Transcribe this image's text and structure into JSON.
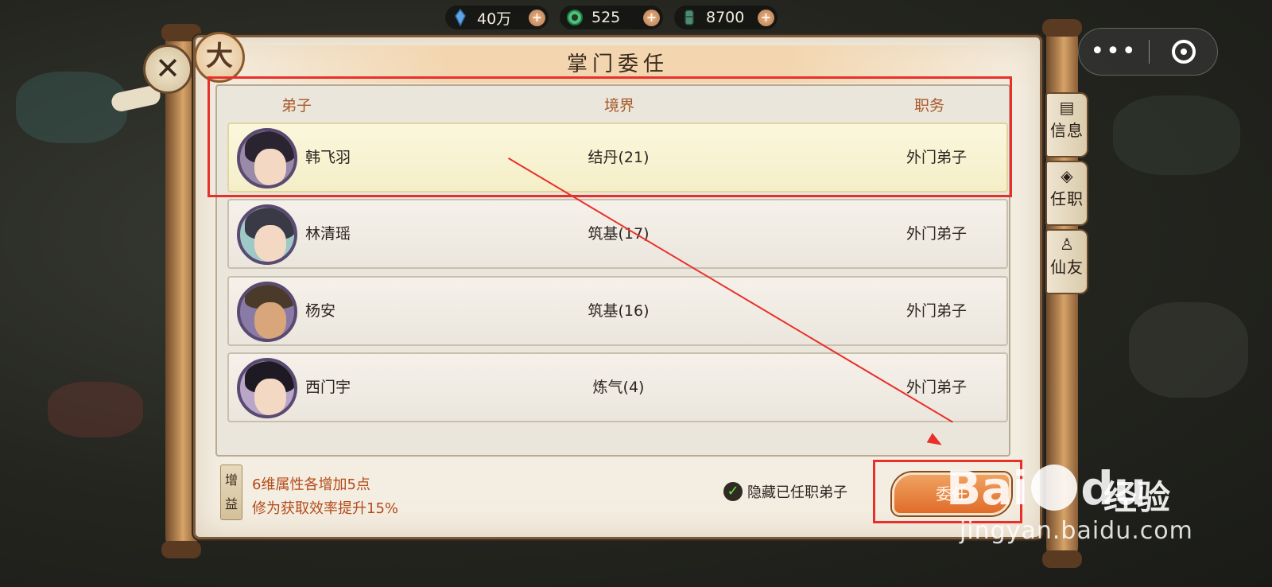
{
  "resources": [
    {
      "icon": "spirit-stone-icon",
      "value": "40万",
      "plus": "+"
    },
    {
      "icon": "jade-ring-icon",
      "value": "525",
      "plus": "+"
    },
    {
      "icon": "bamboo-wood-icon",
      "value": "8700",
      "plus": "+"
    }
  ],
  "capsule": {
    "more": "•••"
  },
  "panel": {
    "title": "掌门委任",
    "badge": "大",
    "close": "✕"
  },
  "columns": {
    "disciple": "弟子",
    "realm": "境界",
    "duty": "职务"
  },
  "rows": [
    {
      "name": "韩飞羽",
      "realm": "结丹(21)",
      "duty": "外门弟子",
      "selected": true
    },
    {
      "name": "林清瑶",
      "realm": "筑基(17)",
      "duty": "外门弟子",
      "selected": false
    },
    {
      "name": "杨安",
      "realm": "筑基(16)",
      "duty": "外门弟子",
      "selected": false
    },
    {
      "name": "西门宇",
      "realm": "炼气(4)",
      "duty": "外门弟子",
      "selected": false
    }
  ],
  "bonus": {
    "tag_top": "增",
    "tag_bottom": "益",
    "line1": "6维属性各增加5点",
    "line2": "修为获取效率提升15%"
  },
  "hide_toggle": {
    "checked": true,
    "check": "✓",
    "label": "隐藏已任职弟子"
  },
  "appoint_button": {
    "label": "委任"
  },
  "side_tabs": [
    {
      "label": "信息",
      "icon": "document-icon"
    },
    {
      "label": "任职",
      "icon": "tag-icon"
    },
    {
      "label": "仙友",
      "icon": "person-icon"
    }
  ],
  "watermark": {
    "logo_a": "Bai",
    "logo_b": "du",
    "cn": "经验",
    "url": "jingyan.baidu.com"
  },
  "colors": {
    "annotation": "#e8302a",
    "accent": "#e06c2a",
    "header_text": "#a8592a"
  }
}
